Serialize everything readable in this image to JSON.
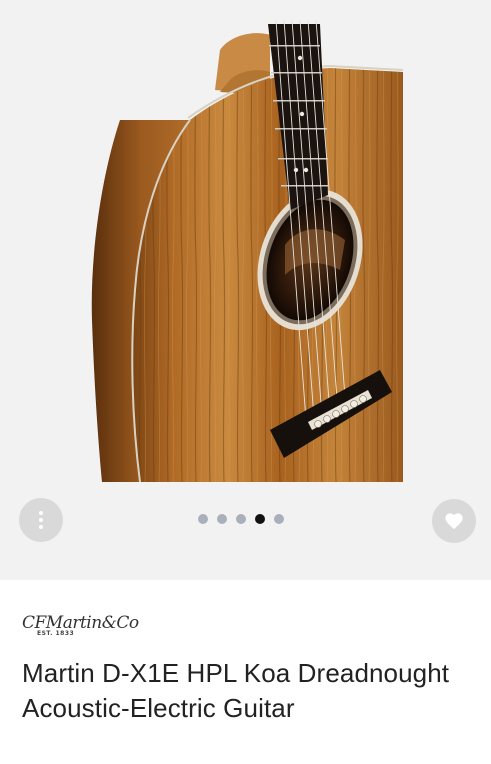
{
  "gallery": {
    "image_alt": "Martin D-X1E HPL Koa Dreadnought Acoustic-Electric Guitar body image",
    "slide_count": 5,
    "active_slide": 4,
    "more_icon": "more-vertical-icon",
    "favorite_icon": "heart-icon"
  },
  "product": {
    "brand_logo": "CFMartin&Co",
    "brand_est": "EST. 1833",
    "title": "Martin D-X1E HPL Koa Dreadnought Acoustic-Electric Guitar"
  },
  "colors": {
    "gallery_bg": "#f2f2f2",
    "button_bg": "#d9d9d9",
    "dot_inactive": "#a9b0bb",
    "dot_active": "#111111",
    "title_text": "#222222"
  }
}
